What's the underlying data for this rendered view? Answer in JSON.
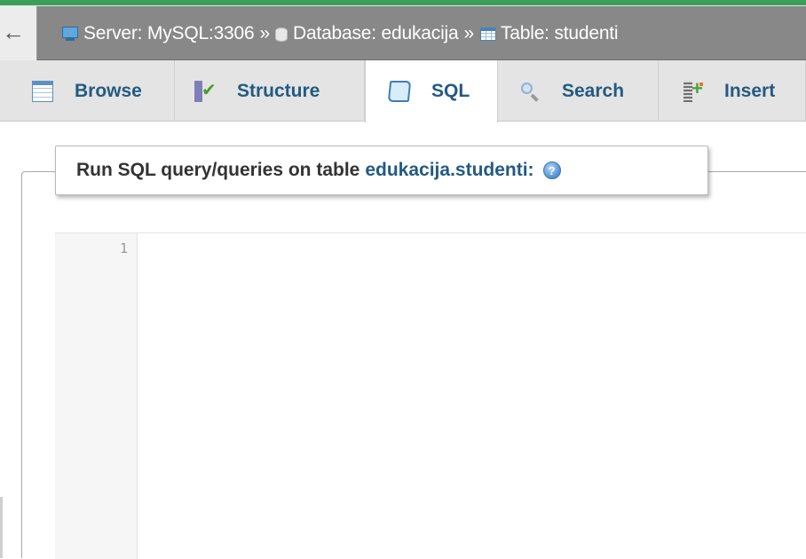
{
  "breadcrumb": {
    "back_symbol": "←",
    "server_label": "Server: MySQL:3306",
    "separator": "»",
    "database_label": "Database: edukacija",
    "table_label": "Table: studenti"
  },
  "tabs": [
    {
      "label": "Browse",
      "icon": "browse-icon",
      "active": false
    },
    {
      "label": "Structure",
      "icon": "structure-icon",
      "active": false
    },
    {
      "label": "SQL",
      "icon": "sql-icon",
      "active": true
    },
    {
      "label": "Search",
      "icon": "search-icon",
      "active": false
    },
    {
      "label": "Insert",
      "icon": "insert-icon",
      "active": false
    }
  ],
  "query_panel": {
    "legend_prefix": "Run SQL query/queries on table",
    "table_name": "edukacija.studenti:",
    "help_symbol": "?"
  },
  "editor": {
    "line_numbers": [
      "1"
    ],
    "content": ""
  },
  "colors": {
    "accent_green": "#3b9f5a",
    "breadcrumb_bg": "#888888",
    "link_blue": "#235a81"
  }
}
